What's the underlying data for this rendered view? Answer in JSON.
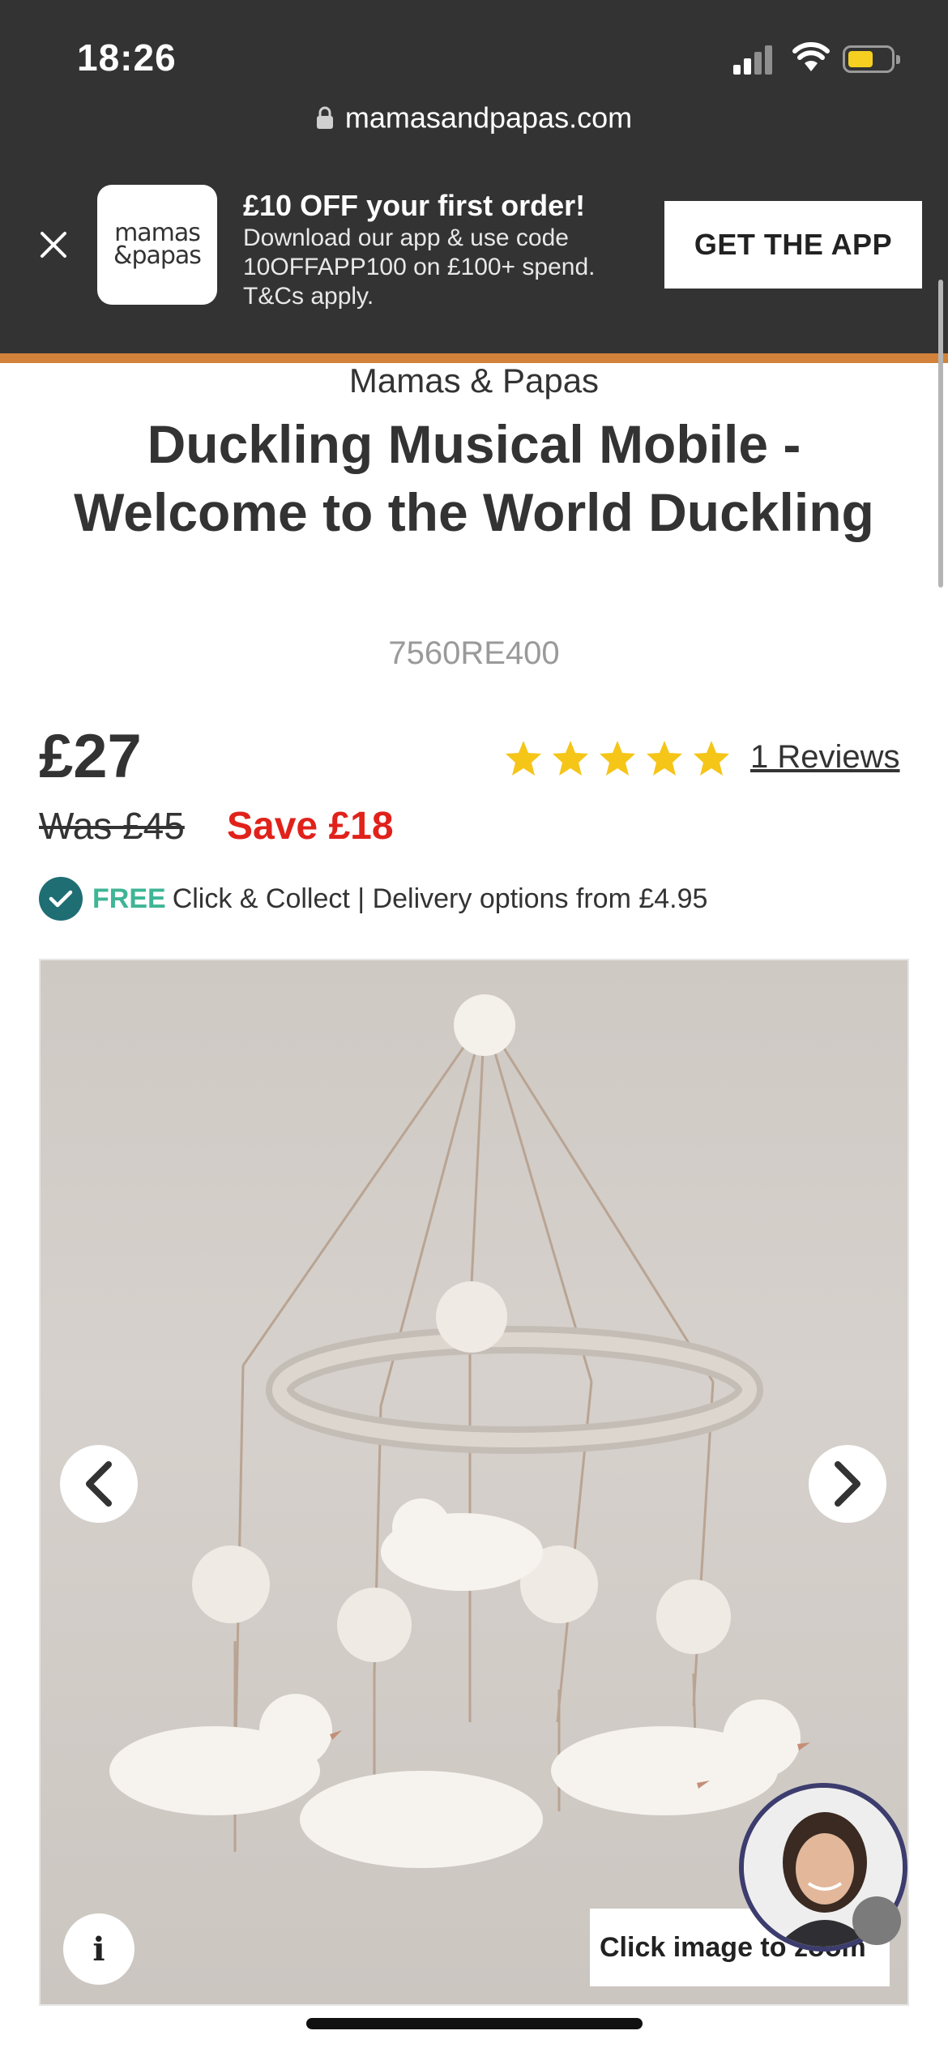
{
  "status_bar": {
    "time": "18:26"
  },
  "browser": {
    "url": "mamasandpapas.com"
  },
  "app_banner": {
    "logo_line1": "mamas",
    "logo_line2": "&papas",
    "title": "£10 OFF your first order!",
    "line1": "Download our app & use code",
    "line2": "10OFFAPP100 on £100+ spend.",
    "line3": "T&Cs apply.",
    "cta": "GET THE APP"
  },
  "product": {
    "brand": "Mamas & Papas",
    "title": "Duckling Musical Mobile - Welcome to the World Duckling",
    "sku": "7560RE400",
    "price": "£27",
    "was_price": "Was £45",
    "save": "Save £18",
    "rating": 5,
    "reviews_label": "1 Reviews",
    "delivery": {
      "free": "FREE",
      "text": "Click & Collect | Delivery options from £4.95"
    }
  },
  "gallery": {
    "zoom_hint": "Click image to zoom"
  },
  "colors": {
    "accent_orange": "#d2823a",
    "sale_red": "#e0221b",
    "free_green": "#3fb596",
    "check_teal": "#1f6e74",
    "star": "#f5c518"
  }
}
